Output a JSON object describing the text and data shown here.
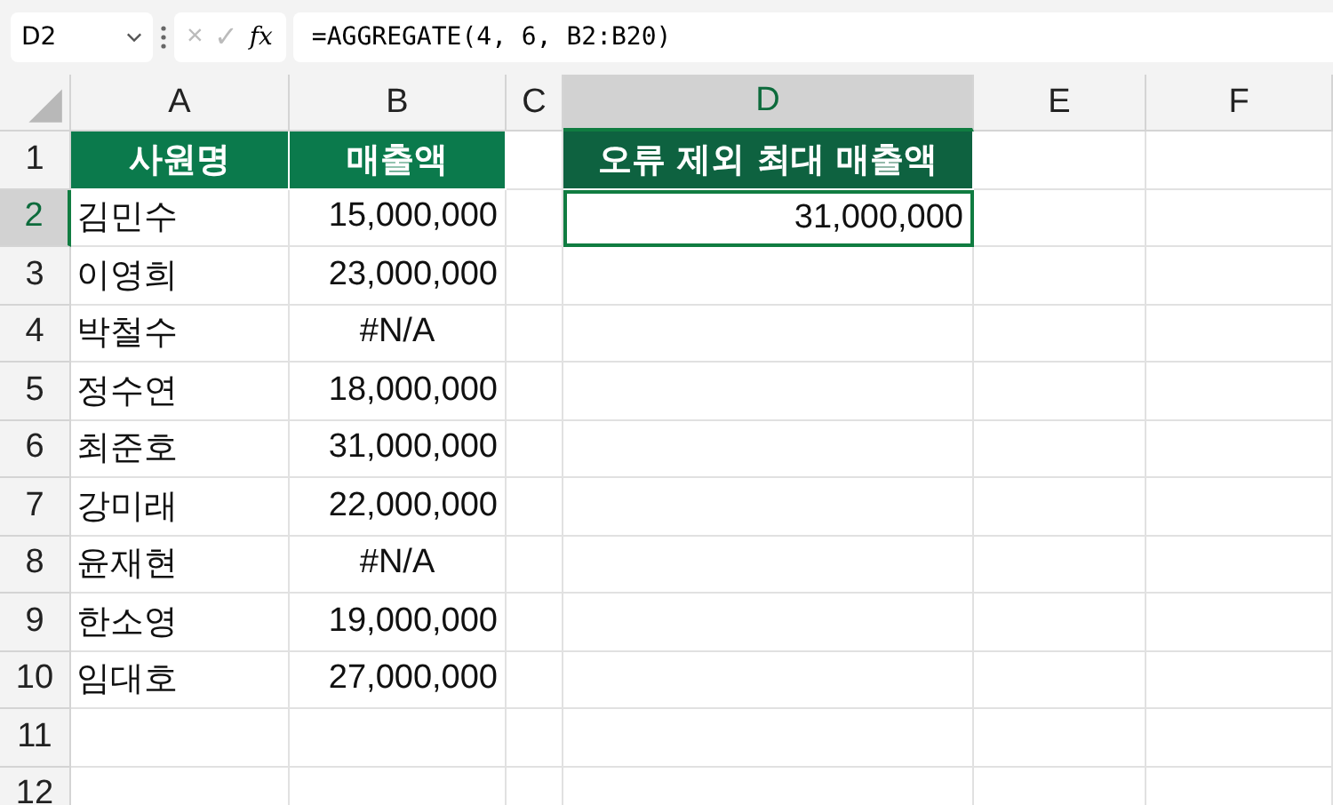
{
  "formula_bar": {
    "name_box": "D2",
    "cancel": {
      "glyph": "×",
      "disabled": true
    },
    "enter": {
      "glyph": "✓",
      "disabled": true
    },
    "function_label": "fx",
    "formula": "=AGGREGATE(4, 6, B2:B20)"
  },
  "columns": [
    {
      "label": "A",
      "selected": false
    },
    {
      "label": "B",
      "selected": false
    },
    {
      "label": "C",
      "selected": false
    },
    {
      "label": "D",
      "selected": true
    },
    {
      "label": "E",
      "selected": false
    },
    {
      "label": "F",
      "selected": false
    }
  ],
  "rows": [
    {
      "label": "1",
      "selected": false,
      "cells": [
        {
          "kind": "header",
          "value": "사원명"
        },
        {
          "kind": "header",
          "value": "매출액"
        },
        null,
        {
          "kind": "title",
          "value": "오류 제외 최대 매출액"
        },
        null,
        null
      ]
    },
    {
      "label": "2",
      "selected": true,
      "cells": [
        {
          "kind": "text",
          "value": "김민수"
        },
        {
          "kind": "number",
          "value": "15,000,000"
        },
        null,
        {
          "kind": "number",
          "value": "31,000,000",
          "selected": true
        },
        null,
        null
      ]
    },
    {
      "label": "3",
      "selected": false,
      "cells": [
        {
          "kind": "text",
          "value": "이영희"
        },
        {
          "kind": "number",
          "value": "23,000,000"
        },
        null,
        null,
        null,
        null
      ]
    },
    {
      "label": "4",
      "selected": false,
      "cells": [
        {
          "kind": "text",
          "value": "박철수"
        },
        {
          "kind": "error",
          "value": "#N/A"
        },
        null,
        null,
        null,
        null
      ]
    },
    {
      "label": "5",
      "selected": false,
      "cells": [
        {
          "kind": "text",
          "value": "정수연"
        },
        {
          "kind": "number",
          "value": "18,000,000"
        },
        null,
        null,
        null,
        null
      ]
    },
    {
      "label": "6",
      "selected": false,
      "cells": [
        {
          "kind": "text",
          "value": "최준호"
        },
        {
          "kind": "number",
          "value": "31,000,000"
        },
        null,
        null,
        null,
        null
      ]
    },
    {
      "label": "7",
      "selected": false,
      "cells": [
        {
          "kind": "text",
          "value": "강미래"
        },
        {
          "kind": "number",
          "value": "22,000,000"
        },
        null,
        null,
        null,
        null
      ]
    },
    {
      "label": "8",
      "selected": false,
      "cells": [
        {
          "kind": "text",
          "value": "윤재현"
        },
        {
          "kind": "error",
          "value": "#N/A"
        },
        null,
        null,
        null,
        null
      ]
    },
    {
      "label": "9",
      "selected": false,
      "cells": [
        {
          "kind": "text",
          "value": "한소영"
        },
        {
          "kind": "number",
          "value": "19,000,000"
        },
        null,
        null,
        null,
        null
      ]
    },
    {
      "label": "10",
      "selected": false,
      "cells": [
        {
          "kind": "text",
          "value": "임대호"
        },
        {
          "kind": "number",
          "value": "27,000,000"
        },
        null,
        null,
        null,
        null
      ]
    },
    {
      "label": "11",
      "selected": false,
      "cells": [
        null,
        null,
        null,
        null,
        null,
        null
      ]
    },
    {
      "label": "12",
      "selected": false,
      "cells": [
        null,
        null,
        null,
        null,
        null,
        null
      ]
    }
  ]
}
